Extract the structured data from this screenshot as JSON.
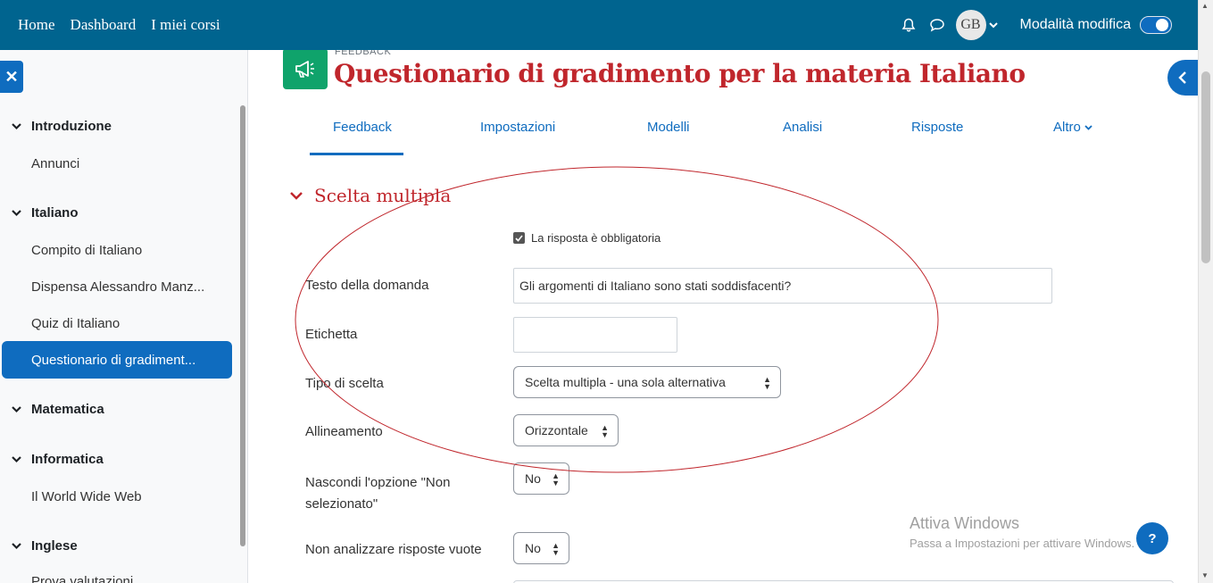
{
  "topnav": {
    "items": [
      "Home",
      "Dashboard",
      "I miei corsi"
    ],
    "avatar_initials": "GB",
    "edit_mode_label": "Modalità modifica"
  },
  "drawer": {
    "sections": [
      {
        "title": "Introduzione",
        "items": [
          "Annunci"
        ]
      },
      {
        "title": "Italiano",
        "items": [
          "Compito di Italiano",
          "Dispensa Alessandro Manz...",
          "Quiz di Italiano",
          "Questionario di gradiment..."
        ]
      },
      {
        "title": "Matematica",
        "items": []
      },
      {
        "title": "Informatica",
        "items": [
          "Il World Wide Web"
        ]
      },
      {
        "title": "Inglese",
        "items": [
          "Prova valutazioni"
        ]
      }
    ]
  },
  "header": {
    "module_label": "FEEDBACK",
    "title": "Questionario di gradimento per la materia Italiano"
  },
  "tabs": [
    "Feedback",
    "Impostazioni",
    "Modelli",
    "Analisi",
    "Risposte",
    "Altro"
  ],
  "form": {
    "section_title": "Scelta multipla",
    "required_label": "La risposta è obbligatoria",
    "question_label": "Testo della domanda",
    "question_value": "Gli argomenti di Italiano sono stati soddisfacenti?",
    "tag_label": "Etichetta",
    "tag_value": "",
    "choice_type_label": "Tipo di scelta",
    "choice_type_value": "Scelta multipla - una sola alternativa",
    "alignment_label": "Allineamento",
    "alignment_value": "Orizzontale",
    "hide_label_line1": "Nascondi l'opzione \"Non",
    "hide_label_line2": "selezionato\"",
    "hide_value": "No",
    "skip_label": "Non analizzare risposte vuote",
    "skip_value": "No"
  },
  "watermark": {
    "line1": "Attiva Windows",
    "line2": "Passa a Impostazioni per attivare Windows."
  },
  "help_label": "?",
  "colors": {
    "topbar": "#00648f",
    "primary": "#0f6cbf",
    "title_red": "#c0262c",
    "module_green": "#0fa36b"
  }
}
